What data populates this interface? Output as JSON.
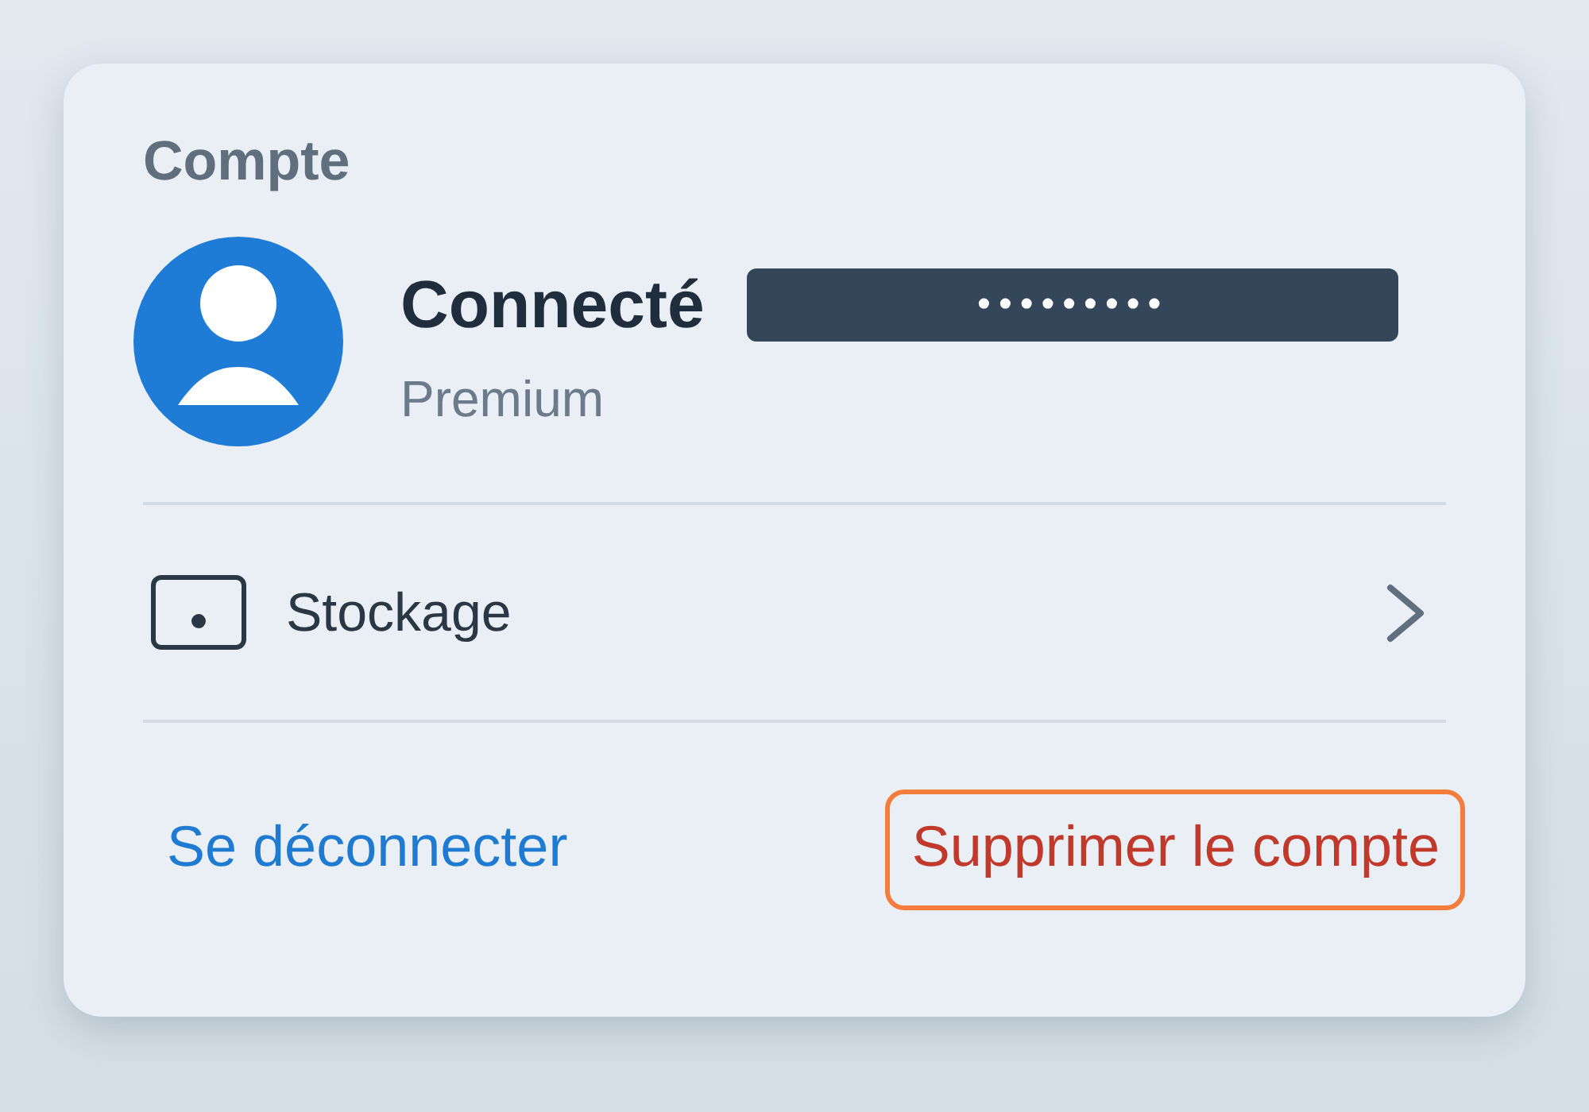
{
  "section": {
    "title": "Compte"
  },
  "account": {
    "status": "Connecté",
    "masked_value": "•••••••••",
    "plan": "Premium"
  },
  "menu_items": [
    {
      "label": "Stockage",
      "kind": "storage"
    }
  ],
  "actions": [
    {
      "label": "Se déconnecter",
      "kind": "link",
      "focused": false
    },
    {
      "label": "Supprimer le compte",
      "kind": "danger",
      "focused": true
    }
  ]
}
